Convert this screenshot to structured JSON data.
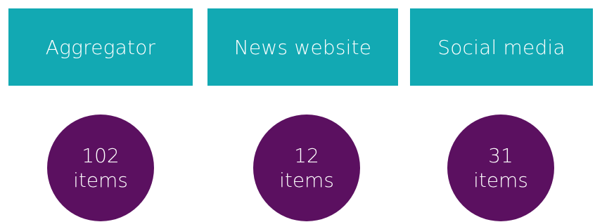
{
  "sources": [
    {
      "label": "Aggregator",
      "count": "102",
      "unit": "items"
    },
    {
      "label": "News website",
      "count": "12",
      "unit": "items"
    },
    {
      "label": "Social media",
      "count": "31",
      "unit": "items"
    }
  ],
  "colors": {
    "box": "#12a9b3",
    "circle": "#5b1060",
    "text": "#ffffff"
  }
}
